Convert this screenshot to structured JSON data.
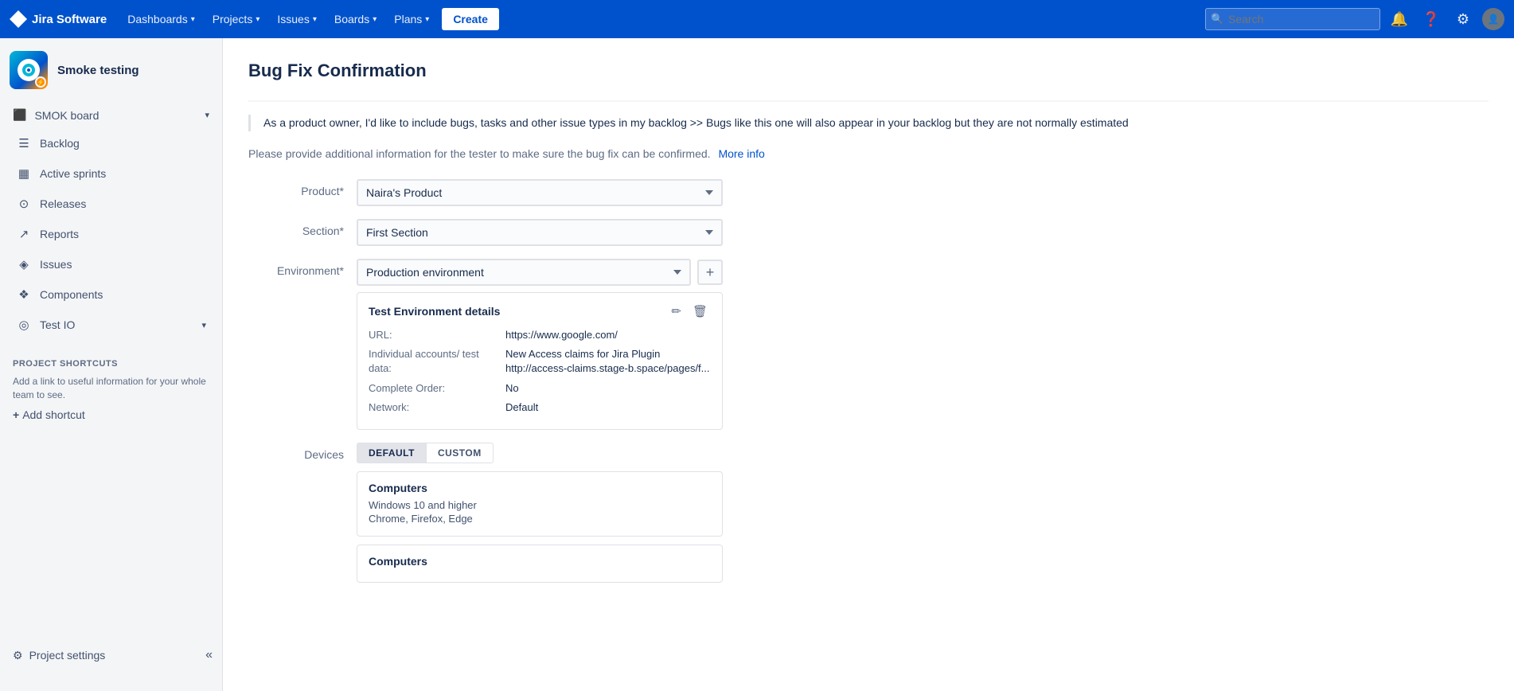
{
  "topnav": {
    "brand": "Jira Software",
    "nav_items": [
      {
        "label": "Dashboards",
        "has_dropdown": true
      },
      {
        "label": "Projects",
        "has_dropdown": true
      },
      {
        "label": "Issues",
        "has_dropdown": true
      },
      {
        "label": "Boards",
        "has_dropdown": true
      },
      {
        "label": "Plans",
        "has_dropdown": true
      }
    ],
    "create_label": "Create",
    "search_placeholder": "Search"
  },
  "sidebar": {
    "project_name": "Smoke testing",
    "board_label": "SMOK board",
    "nav_items": [
      {
        "id": "backlog",
        "label": "Backlog",
        "icon": "☰"
      },
      {
        "id": "active-sprints",
        "label": "Active sprints",
        "icon": "▦"
      },
      {
        "id": "releases",
        "label": "Releases",
        "icon": "⊙"
      },
      {
        "id": "reports",
        "label": "Reports",
        "icon": "↗"
      },
      {
        "id": "issues",
        "label": "Issues",
        "icon": "◈"
      },
      {
        "id": "components",
        "label": "Components",
        "icon": "❖"
      },
      {
        "id": "test-io",
        "label": "Test IO",
        "icon": "◎",
        "has_dropdown": true
      }
    ],
    "shortcuts_label": "PROJECT SHORTCUTS",
    "shortcuts_desc": "Add a link to useful information for your whole team to see.",
    "add_shortcut_label": "Add shortcut",
    "project_settings_label": "Project settings",
    "collapse_icon": "«"
  },
  "main": {
    "title": "Bug Fix Confirmation",
    "description_primary": "As a product owner, I'd like to include bugs, tasks and other issue types in my backlog >> Bugs like this one will also appear in your backlog but they are not normally estimated",
    "description_secondary": "Please provide additional information for the tester to make sure the bug fix can be confirmed.",
    "more_info_label": "More info",
    "form": {
      "product_label": "Product*",
      "product_value": "Naira's Product",
      "product_options": [
        "Naira's Product"
      ],
      "section_label": "Section*",
      "section_value": "First Section",
      "section_options": [
        "First Section"
      ],
      "environment_label": "Environment*",
      "environment_value": "Production environment",
      "environment_options": [
        "Production environment"
      ],
      "env_details": {
        "title": "Test Environment details",
        "url_label": "URL:",
        "url_value": "https://www.google.com/",
        "accounts_label": "Individual accounts/ test data:",
        "accounts_value": "New Access claims for Jira Plugin\nhttp://access-claims.stage-b.space/pages/f...",
        "complete_order_label": "Complete Order:",
        "complete_order_value": "No",
        "network_label": "Network:",
        "network_value": "Default"
      },
      "devices_label": "Devices",
      "device_tab_default": "DEFAULT",
      "device_tab_custom": "CUSTOM",
      "devices_section1": {
        "title": "Computers",
        "os": "Windows 10 and higher",
        "browsers": "Chrome, Firefox, Edge"
      },
      "devices_section2": {
        "title": "Computers"
      }
    }
  }
}
